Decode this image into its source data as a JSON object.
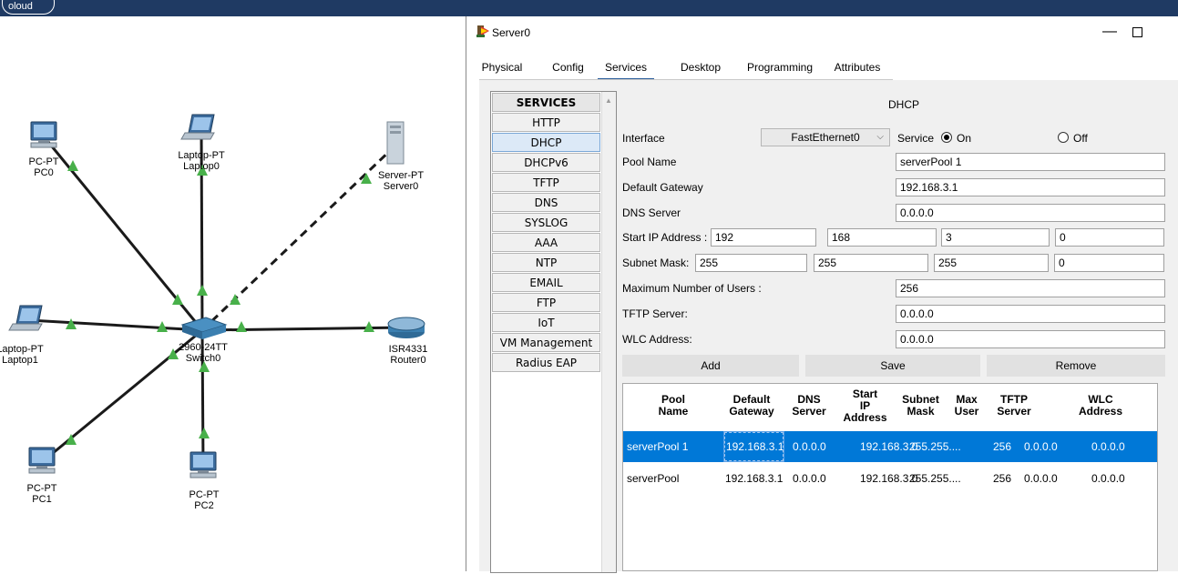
{
  "main_window": {
    "cloud_label": "oloud"
  },
  "topology": {
    "devices": [
      {
        "id": "pc0",
        "type_label": "PC-PT",
        "name": "PC0"
      },
      {
        "id": "laptop0",
        "type_label": "Laptop-PT",
        "name": "Laptop0"
      },
      {
        "id": "server0",
        "type_label": "Server-PT",
        "name": "Server0"
      },
      {
        "id": "laptop1",
        "type_label": "Laptop-PT",
        "name": "Laptop1"
      },
      {
        "id": "switch0",
        "type_label": "2960-24TT",
        "name": "Switch0"
      },
      {
        "id": "router0",
        "type_label": "ISR4331",
        "name": "Router0"
      },
      {
        "id": "pc1",
        "type_label": "PC-PT",
        "name": "PC1"
      },
      {
        "id": "pc2",
        "type_label": "PC-PT",
        "name": "PC2"
      }
    ],
    "link_color": "#1a1a1a",
    "link_up_color": "#48b04a"
  },
  "window": {
    "title": "Server0",
    "tabs": [
      {
        "label": "Physical",
        "active": false
      },
      {
        "label": "Config",
        "active": false
      },
      {
        "label": "Services",
        "active": true
      },
      {
        "label": "Desktop",
        "active": false
      },
      {
        "label": "Programming",
        "active": false
      },
      {
        "label": "Attributes",
        "active": false
      }
    ]
  },
  "services": {
    "header": "SERVICES",
    "items": [
      "HTTP",
      "DHCP",
      "DHCPv6",
      "TFTP",
      "DNS",
      "SYSLOG",
      "AAA",
      "NTP",
      "EMAIL",
      "FTP",
      "IoT",
      "VM Management",
      "Radius EAP"
    ],
    "selected": "DHCP"
  },
  "dhcp": {
    "title": "DHCP",
    "interface_label": "Interface",
    "interface_value": "FastEthernet0",
    "service_label": "Service",
    "on_label": "On",
    "off_label": "Off",
    "service_on": true,
    "pool_name_label": "Pool Name",
    "pool_name_value": "serverPool 1",
    "gateway_label": "Default Gateway",
    "gateway_value": "192.168.3.1",
    "dns_label": "DNS Server",
    "dns_value": "0.0.0.0",
    "start_ip_label": "Start IP Address :",
    "start_ip": [
      "192",
      "168",
      "3",
      "0"
    ],
    "mask_label": "Subnet Mask:",
    "mask": [
      "255",
      "255",
      "255",
      "0"
    ],
    "max_users_label": "Maximum Number of Users :",
    "max_users_value": "256",
    "tftp_label": "TFTP Server:",
    "tftp_value": "0.0.0.0",
    "wlc_label": "WLC Address:",
    "wlc_value": "0.0.0.0",
    "add_label": "Add",
    "save_label": "Save",
    "remove_label": "Remove"
  },
  "pool_table": {
    "headers": [
      [
        "Pool",
        "Name"
      ],
      [
        "Default",
        "Gateway"
      ],
      [
        "DNS",
        "Server"
      ],
      [
        "Start",
        "IP",
        "Address"
      ],
      [
        "Subnet",
        "Mask"
      ],
      [
        "Max",
        "User"
      ],
      [
        "TFTP",
        "Server"
      ],
      [
        "WLC",
        "Address"
      ]
    ],
    "rows": [
      {
        "selected": true,
        "cells": [
          "serverPool 1",
          "192.168.3.1",
          "0.0.0.0",
          "192.168.3.0",
          "255.255....",
          "256",
          "0.0.0.0",
          "0.0.0.0"
        ]
      },
      {
        "selected": false,
        "cells": [
          "serverPool",
          "192.168.3.1",
          "0.0.0.0",
          "192.168.3.0",
          "255.255....",
          "256",
          "0.0.0.0",
          "0.0.0.0"
        ]
      }
    ],
    "selection_color": "#0078d7"
  }
}
